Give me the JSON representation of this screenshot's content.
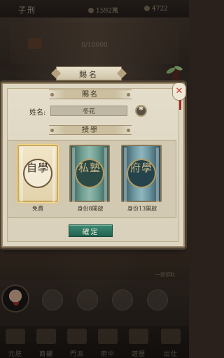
{
  "hud": {
    "player_name": "子刑",
    "stat1_value": "1592萬",
    "stat2_value": "4722",
    "exp_text": "0/10000"
  },
  "dialog": {
    "title": "賜名",
    "name_section_title": "賜名",
    "name_label": "姓名:",
    "name_value": "冬花",
    "study_section_title": "授學",
    "options": [
      {
        "seal_text": "自學",
        "caption": "免費",
        "selected": true
      },
      {
        "seal_text": "私塾",
        "caption": "身份8開啟",
        "selected": false
      },
      {
        "seal_text": "府學",
        "caption": "身份13開啟",
        "selected": false
      }
    ],
    "confirm_label": "確定",
    "close_glyph": "✕"
  },
  "bottom_nav": {
    "side_label": "一鍵領取",
    "items": [
      {
        "label": "元胚"
      },
      {
        "label": "商舖"
      },
      {
        "label": "門派"
      },
      {
        "label": "府中"
      },
      {
        "label": "遊歷"
      },
      {
        "label": "出仕"
      }
    ]
  },
  "colors": {
    "confirm_button": "#2f7a64",
    "close_x": "#c2352a",
    "selected_card_glow": "#f3d98e",
    "dialog_bg": "#ddd6c3"
  }
}
